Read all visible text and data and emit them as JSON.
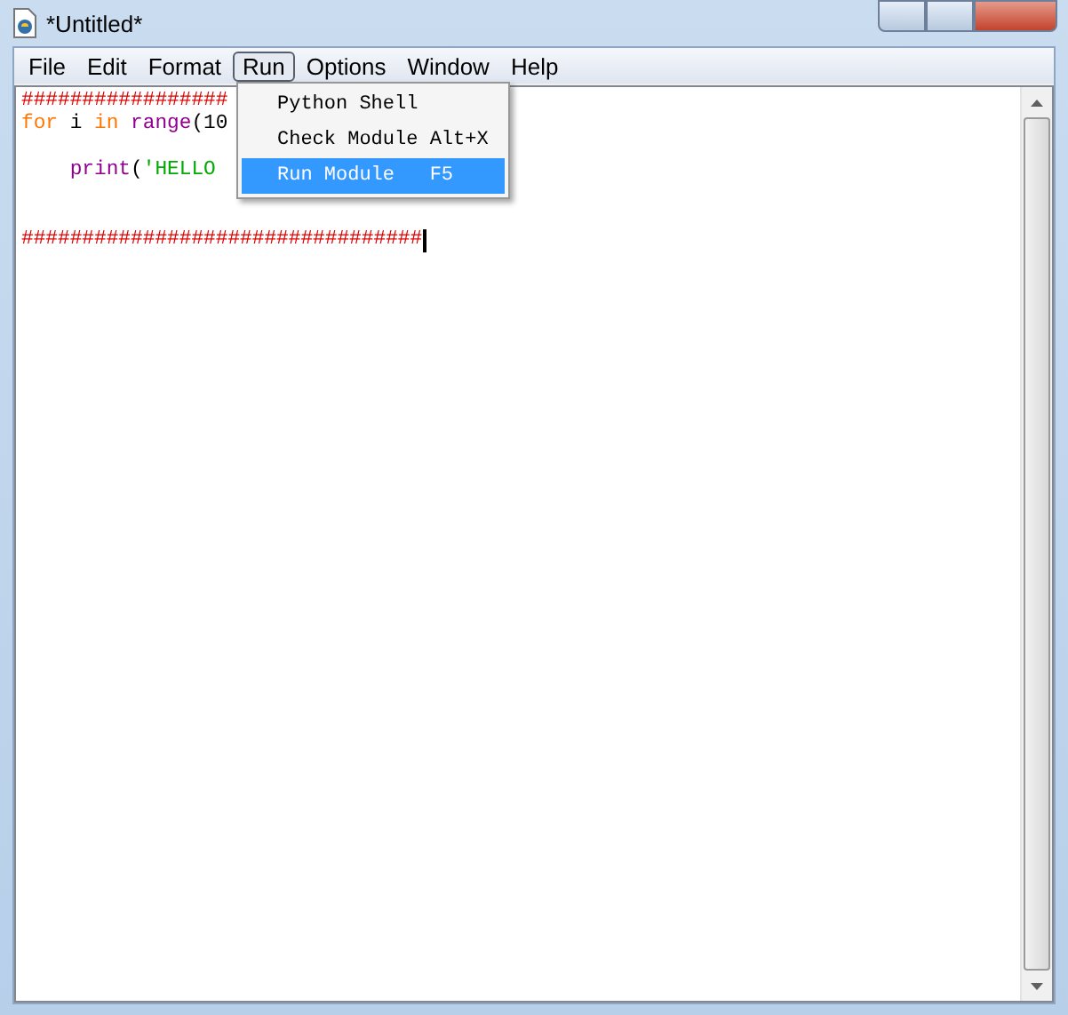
{
  "window": {
    "title": "*Untitled*"
  },
  "menu_bar": [
    {
      "label": "File",
      "selected": false
    },
    {
      "label": "Edit",
      "selected": false
    },
    {
      "label": "Format",
      "selected": false
    },
    {
      "label": "Run",
      "selected": true
    },
    {
      "label": "Options",
      "selected": false
    },
    {
      "label": "Window",
      "selected": false
    },
    {
      "label": "Help",
      "selected": false
    }
  ],
  "editor": {
    "lines": [
      {
        "kind": "code",
        "cursor": false,
        "tokens": [
          {
            "kind": "comment",
            "text": "#################"
          }
        ]
      },
      {
        "kind": "code",
        "cursor": false,
        "tokens": [
          {
            "kind": "keyword",
            "text": "for"
          },
          {
            "kind": "plain",
            "text": " i "
          },
          {
            "kind": "keyword",
            "text": "in"
          },
          {
            "kind": "builtin",
            "text": " range"
          },
          {
            "kind": "plain",
            "text": "(10"
          }
        ]
      },
      {
        "kind": "blank"
      },
      {
        "kind": "code",
        "cursor": false,
        "tokens": [
          {
            "kind": "builtin",
            "text": "    print"
          },
          {
            "kind": "plain",
            "text": "("
          },
          {
            "kind": "string",
            "text": "'HELLO"
          }
        ]
      },
      {
        "kind": "blank"
      },
      {
        "kind": "blank"
      },
      {
        "kind": "code",
        "cursor": true,
        "tokens": [
          {
            "kind": "comment",
            "text": "#################################"
          }
        ]
      }
    ]
  },
  "run_menu": [
    {
      "label": "Python Shell",
      "selected": false
    },
    {
      "label": "Check Module Alt+X",
      "selected": false
    },
    {
      "label": "Run Module   F5",
      "selected": true
    }
  ]
}
